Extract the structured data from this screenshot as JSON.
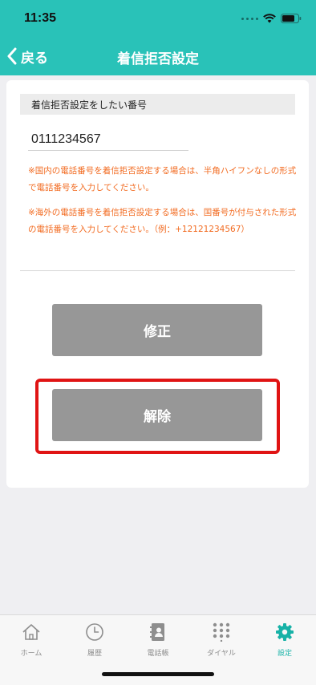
{
  "status_bar": {
    "time": "11:35"
  },
  "nav": {
    "back_label": "戻る",
    "title": "着信拒否設定"
  },
  "form": {
    "section_header": "着信拒否設定をしたい番号",
    "number_value": "0111234567",
    "note_domestic": "※国内の電話番号を着信拒否設定する場合は、半角ハイフンなしの形式で電話番号を入力してください。",
    "note_international": "※海外の電話番号を着信拒否設定する場合は、国番号が付与された形式の電話番号を入力してください。（例：+12121234567）"
  },
  "buttons": {
    "edit_label": "修正",
    "release_label": "解除"
  },
  "tab_bar": {
    "items": [
      {
        "label": "ホーム",
        "icon": "home-icon"
      },
      {
        "label": "履歴",
        "icon": "clock-icon"
      },
      {
        "label": "電話帳",
        "icon": "contacts-icon"
      },
      {
        "label": "ダイヤル",
        "icon": "dialpad-icon"
      },
      {
        "label": "設定",
        "icon": "gear-icon"
      }
    ],
    "active_index": 4
  },
  "colors": {
    "brand": "#29c2b8",
    "note": "#f26b21",
    "button": "#979797",
    "highlight": "#e01414",
    "tab_active": "#17b2a7"
  }
}
